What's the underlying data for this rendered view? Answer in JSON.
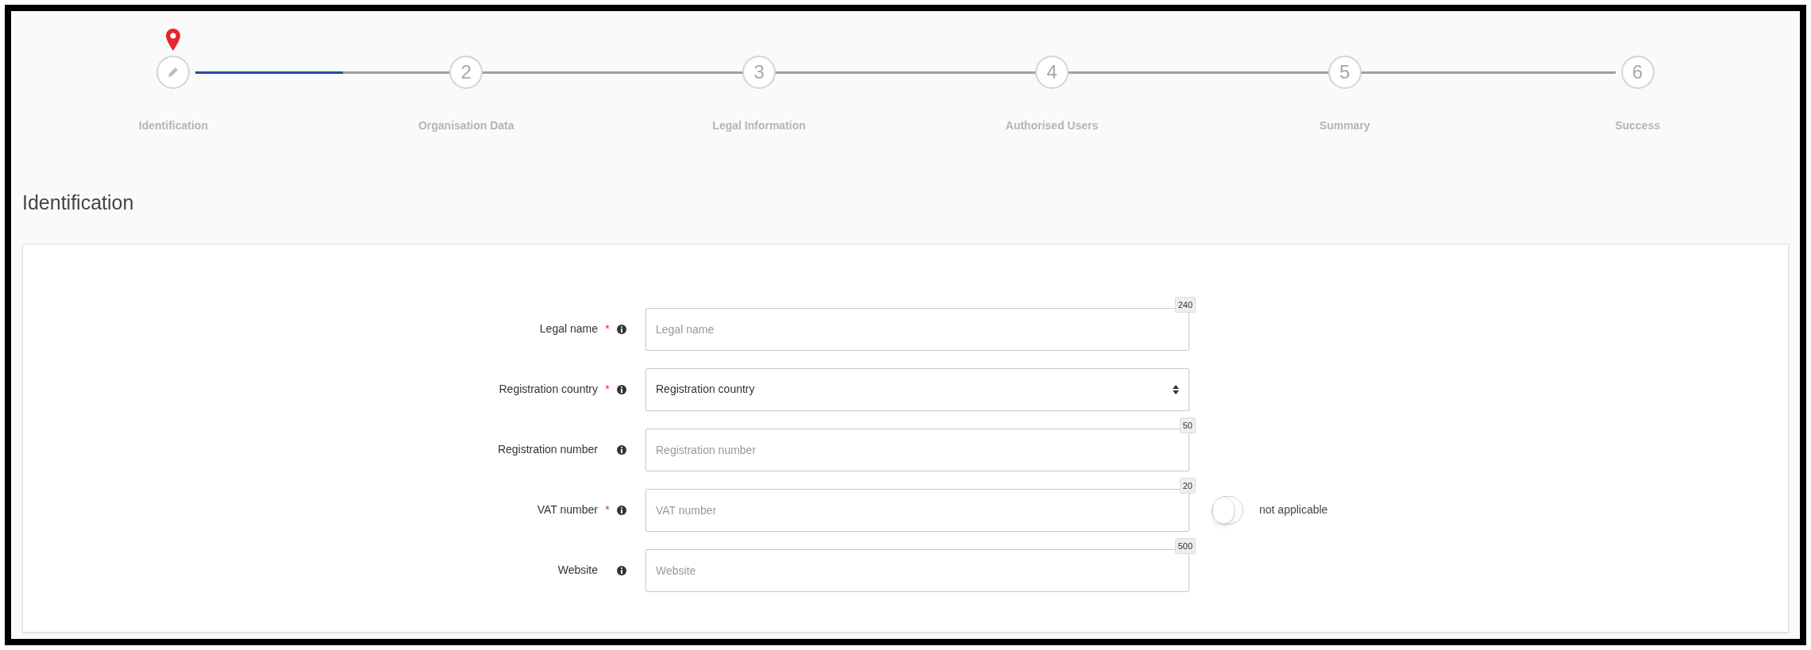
{
  "stepper": {
    "level": 0.5,
    "steps": [
      {
        "label": "Identification",
        "selected": true
      },
      {
        "label": "Organisation Data",
        "number": "2",
        "selected": false
      },
      {
        "label": "Legal Information",
        "number": "3",
        "selected": false
      },
      {
        "label": "Authorised Users",
        "number": "4",
        "selected": false
      },
      {
        "label": "Summary",
        "number": "5",
        "selected": false
      },
      {
        "label": "Success",
        "number": "6",
        "selected": false
      }
    ]
  },
  "section_title": "Identification",
  "fields": [
    {
      "kind": "text",
      "label": "Legal name",
      "required_mark": "*",
      "placeholder": "Legal name",
      "counter": "240"
    },
    {
      "kind": "select",
      "label": "Registration country",
      "required_mark": "*",
      "value": "Registration country"
    },
    {
      "kind": "text",
      "label": "Registration number",
      "placeholder": "Registration number",
      "counter": "50"
    },
    {
      "kind": "text",
      "label": "VAT number",
      "required_mark": "*",
      "placeholder": "VAT number",
      "counter": "20",
      "toggle": {
        "label": "not applicable",
        "on": false
      }
    },
    {
      "kind": "text",
      "label": "Website",
      "placeholder": "Website",
      "counter": "500"
    }
  ]
}
